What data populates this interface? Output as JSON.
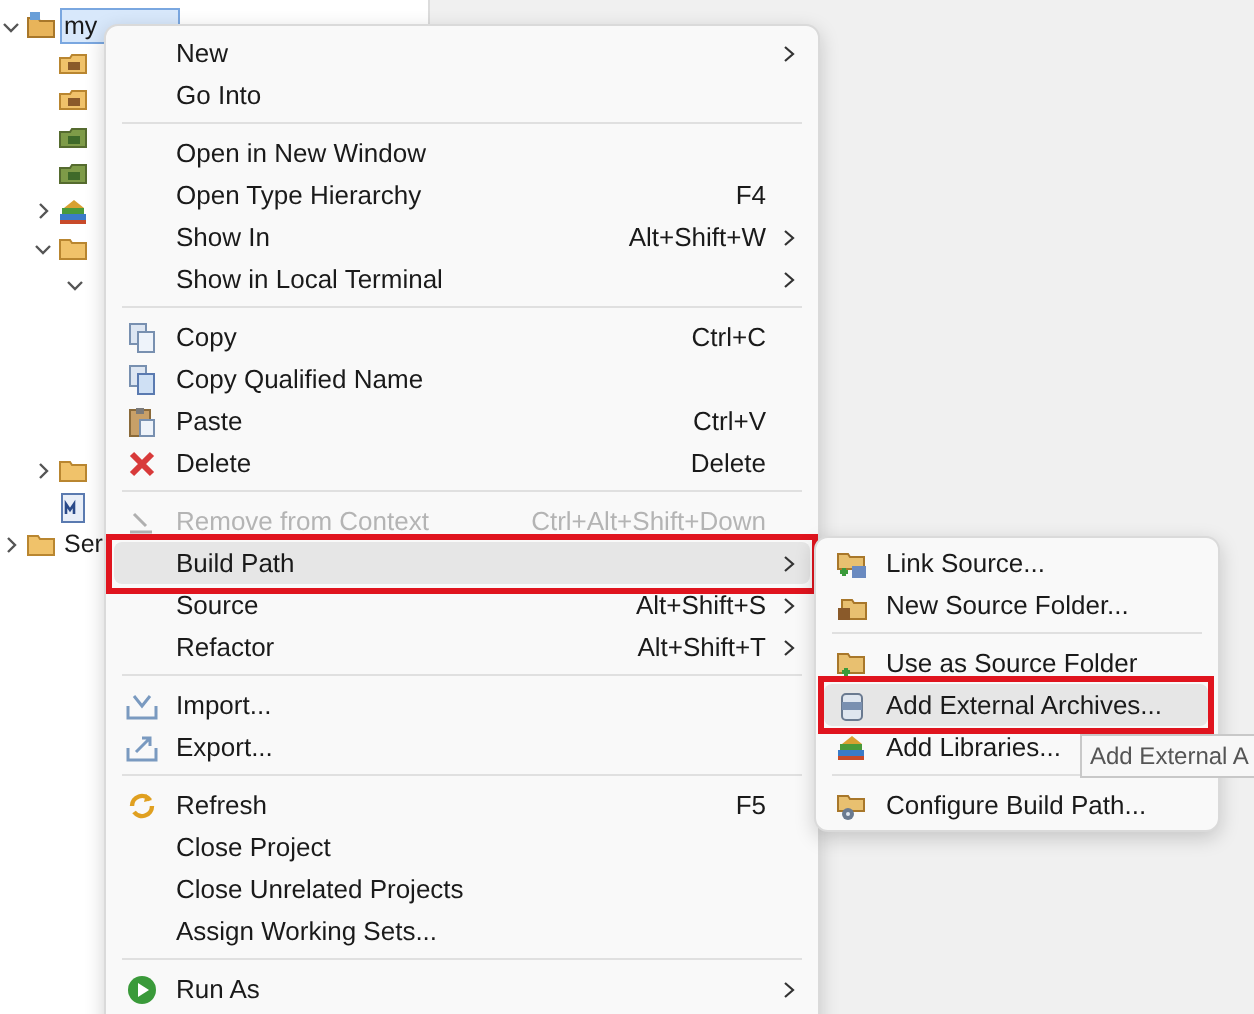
{
  "tree": [
    {
      "label": "my",
      "kind": "project",
      "expanded": true,
      "selected": true,
      "children": [
        {
          "kind": "package"
        },
        {
          "kind": "package"
        },
        {
          "kind": "greenpackage"
        },
        {
          "kind": "greenpackage"
        },
        {
          "kind": "library",
          "expanded": false
        },
        {
          "kind": "folder",
          "expanded": true,
          "children": [
            {
              "expanded": true
            }
          ]
        },
        {
          "kind": "folder",
          "expanded": false
        },
        {
          "kind": "file"
        }
      ]
    },
    {
      "label": "Ser",
      "kind": "folder",
      "expanded": false
    }
  ],
  "context_menu": [
    {
      "kind": "plain",
      "label": "New",
      "submenu": true,
      "disabled": false,
      "selected": false,
      "marked": false
    },
    {
      "kind": "plain",
      "label": "Go Into",
      "submenu": false,
      "disabled": false,
      "selected": false,
      "marked": false
    },
    {
      "kind": "separator"
    },
    {
      "kind": "plain",
      "label": "Open in New Window",
      "submenu": false,
      "disabled": false,
      "selected": false,
      "marked": false
    },
    {
      "kind": "plain",
      "label": "Open Type Hierarchy",
      "shortcut": "F4",
      "submenu": false,
      "disabled": false,
      "selected": false,
      "marked": false
    },
    {
      "kind": "plain",
      "label": "Show In",
      "shortcut": "Alt+Shift+W",
      "submenu": true,
      "disabled": false,
      "selected": false,
      "marked": false
    },
    {
      "kind": "plain",
      "label": "Show in Local Terminal",
      "submenu": true,
      "disabled": false,
      "selected": false,
      "marked": false
    },
    {
      "kind": "separator"
    },
    {
      "kind": "copy",
      "label": "Copy",
      "shortcut": "Ctrl+C",
      "submenu": false,
      "disabled": false,
      "selected": false,
      "marked": false
    },
    {
      "kind": "copyname",
      "label": "Copy Qualified Name",
      "submenu": false,
      "disabled": false,
      "selected": false,
      "marked": false
    },
    {
      "kind": "paste",
      "label": "Paste",
      "shortcut": "Ctrl+V",
      "submenu": false,
      "disabled": false,
      "selected": false,
      "marked": false
    },
    {
      "kind": "delete",
      "label": "Delete",
      "shortcut": "Delete",
      "submenu": false,
      "disabled": false,
      "selected": false,
      "marked": false
    },
    {
      "kind": "separator"
    },
    {
      "kind": "remove",
      "label": "Remove from Context",
      "shortcut": "Ctrl+Alt+Shift+Down",
      "submenu": false,
      "disabled": true,
      "selected": false,
      "marked": false
    },
    {
      "kind": "plain",
      "label": "Build Path",
      "submenu": true,
      "disabled": false,
      "selected": true,
      "marked": true
    },
    {
      "kind": "plain",
      "label": "Source",
      "shortcut": "Alt+Shift+S",
      "submenu": true,
      "disabled": false,
      "selected": false,
      "marked": false
    },
    {
      "kind": "plain",
      "label": "Refactor",
      "shortcut": "Alt+Shift+T",
      "submenu": true,
      "disabled": false,
      "selected": false,
      "marked": false
    },
    {
      "kind": "separator"
    },
    {
      "kind": "import",
      "label": "Import...",
      "submenu": false,
      "disabled": false,
      "selected": false,
      "marked": false
    },
    {
      "kind": "export",
      "label": "Export...",
      "submenu": false,
      "disabled": false,
      "selected": false,
      "marked": false
    },
    {
      "kind": "separator"
    },
    {
      "kind": "refresh",
      "label": "Refresh",
      "shortcut": "F5",
      "submenu": false,
      "disabled": false,
      "selected": false,
      "marked": false
    },
    {
      "kind": "plain",
      "label": "Close Project",
      "submenu": false,
      "disabled": false,
      "selected": false,
      "marked": false
    },
    {
      "kind": "plain",
      "label": "Close Unrelated Projects",
      "submenu": false,
      "disabled": false,
      "selected": false,
      "marked": false
    },
    {
      "kind": "plain",
      "label": "Assign Working Sets...",
      "submenu": false,
      "disabled": false,
      "selected": false,
      "marked": false
    },
    {
      "kind": "separator"
    },
    {
      "kind": "run",
      "label": "Run As",
      "submenu": true,
      "disabled": false,
      "selected": false,
      "marked": false
    }
  ],
  "submenu": [
    {
      "kind": "linksource",
      "label": "Link Source...",
      "submenu": false,
      "disabled": false,
      "selected": false,
      "marked": false
    },
    {
      "kind": "newfolder",
      "label": "New Source Folder...",
      "submenu": false,
      "disabled": false,
      "selected": false,
      "marked": false
    },
    {
      "kind": "separator"
    },
    {
      "kind": "usesource",
      "label": "Use as Source Folder",
      "submenu": false,
      "disabled": false,
      "selected": false,
      "marked": false
    },
    {
      "kind": "archive",
      "label": "Add External Archives...",
      "submenu": false,
      "disabled": false,
      "selected": true,
      "marked": true
    },
    {
      "kind": "libraries",
      "label": "Add Libraries...",
      "submenu": false,
      "disabled": false,
      "selected": false,
      "marked": false
    },
    {
      "kind": "separator"
    },
    {
      "kind": "configure",
      "label": "Configure Build Path...",
      "submenu": false,
      "disabled": false,
      "selected": false,
      "marked": false
    }
  ],
  "tooltip": {
    "text": "Add External A"
  }
}
